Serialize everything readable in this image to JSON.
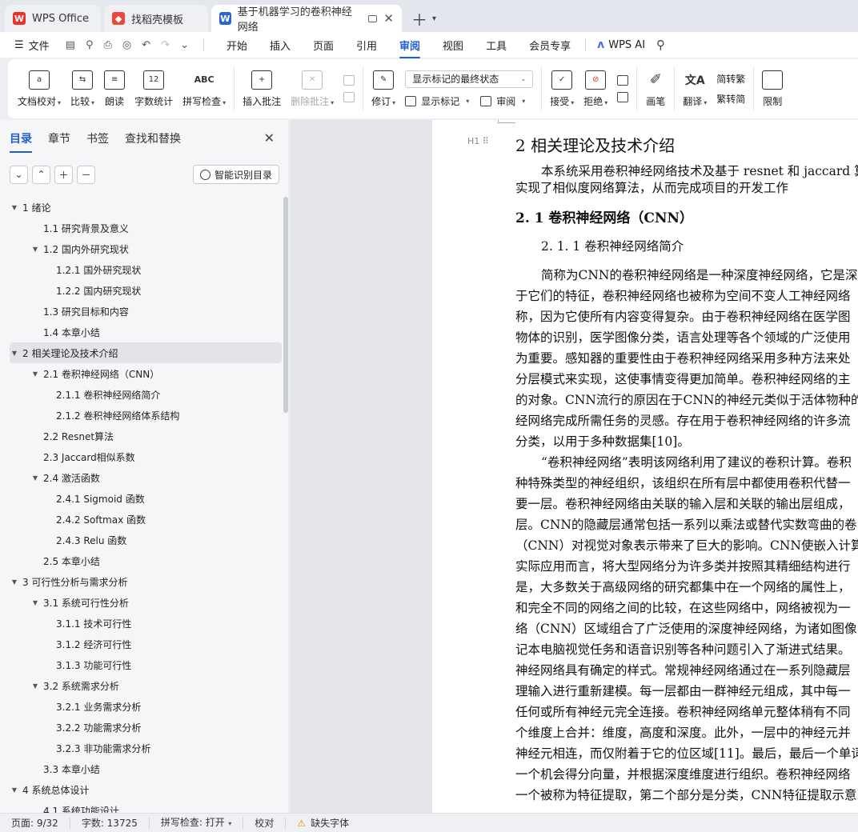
{
  "tabs": {
    "wps": "WPS Office",
    "template": "找稻壳模板",
    "document": "基于机器学习的卷积神经网络"
  },
  "menu": {
    "file": "文件",
    "items": [
      "开始",
      "插入",
      "页面",
      "引用",
      "审阅",
      "视图",
      "工具",
      "会员专享"
    ],
    "active": "审阅",
    "ai": "WPS AI"
  },
  "ribbon": {
    "doc_check": "文档校对",
    "compare": "比较",
    "read_aloud": "朗读",
    "word_count": "字数统计",
    "word_count_icon": "12",
    "spell_check": "拼写检查",
    "spell_icon": "ABC",
    "insert_comment": "插入批注",
    "delete_comment": "删除批注",
    "revise": "修订",
    "markup_mode": "显示标记的最终状态",
    "show_markup": "显示标记",
    "review": "审阅",
    "accept": "接受",
    "reject": "拒绝",
    "pen": "画笔",
    "translate": "翻译",
    "to_traditional": "简转繁",
    "to_simplified": "繁转简",
    "restrict": "限制"
  },
  "nav": {
    "tabs": [
      "目录",
      "章节",
      "书签",
      "查找和替换"
    ],
    "smart_toc": "智能识别目录",
    "toc": [
      {
        "label": "1  绪论",
        "level": 0,
        "arrow": true
      },
      {
        "label": "1.1  研究背景及意义",
        "level": 1
      },
      {
        "label": "1.2  国内外研究现状",
        "level": 1,
        "arrow": true
      },
      {
        "label": "1.2.1  国外研究现状",
        "level": 2
      },
      {
        "label": "1.2.2  国内研究现状",
        "level": 2
      },
      {
        "label": "1.3  研究目标和内容",
        "level": 1
      },
      {
        "label": "1.4  本章小结",
        "level": 1
      },
      {
        "label": "2  相关理论及技术介绍",
        "level": 0,
        "arrow": true,
        "selected": true
      },
      {
        "label": "2.1  卷积神经网络（CNN）",
        "level": 1,
        "arrow": true
      },
      {
        "label": "2.1.1  卷积神经网络简介",
        "level": 2
      },
      {
        "label": "2.1.2  卷积神经网络体系结构",
        "level": 2
      },
      {
        "label": "2.2 Resnet算法",
        "level": 1
      },
      {
        "label": "2.3 Jaccard相似系数",
        "level": 1
      },
      {
        "label": "2.4  激活函数",
        "level": 1,
        "arrow": true
      },
      {
        "label": "2.4.1 Sigmoid 函数",
        "level": 2
      },
      {
        "label": "2.4.2 Softmax 函数",
        "level": 2
      },
      {
        "label": "2.4.3 Relu 函数",
        "level": 2
      },
      {
        "label": "2.5  本章小结",
        "level": 1
      },
      {
        "label": "3 可行性分析与需求分析",
        "level": 0,
        "arrow": true
      },
      {
        "label": "3.1  系统可行性分析",
        "level": 1,
        "arrow": true
      },
      {
        "label": "3.1.1 技术可行性",
        "level": 2
      },
      {
        "label": "3.1.2 经济可行性",
        "level": 2
      },
      {
        "label": "3.1.3 功能可行性",
        "level": 2
      },
      {
        "label": "3.2  系统需求分析",
        "level": 1,
        "arrow": true
      },
      {
        "label": "3.2.1  业务需求分析",
        "level": 2
      },
      {
        "label": "3.2.2  功能需求分析",
        "level": 2
      },
      {
        "label": "3.2.3  非功能需求分析",
        "level": 2
      },
      {
        "label": "3.3  本章小结",
        "level": 1
      },
      {
        "label": "4  系统总体设计",
        "level": 0,
        "arrow": true
      },
      {
        "label": "4.1  系统功能设计",
        "level": 1
      }
    ]
  },
  "doc": {
    "heading_marker": "H1",
    "h1": "2  相关理论及技术介绍",
    "intro": [
      "本系统采用卷积神经网络技术及基于 resnet 和 jaccard 算法",
      "实现了相似度网络算法，从而完成项目的开发工作"
    ],
    "h2": "2. 1  卷积神经网络（CNN）",
    "h3": "2. 1. 1  卷积神经网络简介",
    "body": [
      "简称为CNN的卷积神经网络是一种深度神经网络，它是深度",
      "于它们的特征，卷积神经网络也被称为空间不变人工神经网络",
      "称，因为它使所有内容变得复杂。由于卷积神经网络在医学图",
      "物体的识别，医学图像分类，语言处理等各个领域的广泛使用",
      "为重要。感知器的重要性由于卷积神经网络采用多种方法来处",
      "分层模式来实现，这使事情变得更加简单。卷积神经网络的主",
      "的对象。CNN流行的原因在于CNN的神经元类似于活体物种的",
      "经网络完成所需任务的灵感。存在用于卷积神经网络的许多流",
      "分类，以用于多种数据集[10]。",
      "“卷积神经网络”表明该网络利用了建议的卷积计算。卷积",
      "种特殊类型的神经组织，该组织在所有层中都使用卷积代替一",
      "要一层。卷积神经网络由关联的输入层和关联的输出层组成，",
      "层。CNN的隐藏层通常包括一系列以乘法或替代实数弯曲的卷",
      "（CNN）对视觉对象表示带来了巨大的影响。CNN使嵌入计算",
      "实际应用而言，将大型网络分为许多类并按照其精细结构进行",
      "是，大多数关于高级网络的研究都集中在一个网络的属性上，",
      "和完全不同的网络之间的比较，在这些网络中，网络被视为一",
      "络（CNN）区域组合了广泛使用的深度神经网络，为诸如图像",
      "记本电脑视觉任务和语音识别等各种问题引入了渐进式结果。",
      "神经网络具有确定的样式。常规神经网络通过在一系列隐藏层",
      "理输入进行重新建模。每一层都由一群神经元组成，其中每一",
      "任何或所有神经元完全连接。卷积神经网络单元整体稍有不同",
      "个维度上合并：维度，高度和深度。此外，一层中的神经元并",
      "神经元相连，而仅附着于它的位区域[11]。最后，最后一个单词",
      "一个机会得分向量，并根据深度维度进行组织。卷积神经网络",
      "一个被称为特征提取，第二个部分是分类，CNN特征提取示意"
    ]
  },
  "status": {
    "page": "页面: 9/32",
    "words": "字数: 13725",
    "spell": "拼写检查: 打开",
    "proof": "校对",
    "missing_font": "缺失字体"
  },
  "colors": {
    "accent": "#1f5fd1",
    "wps_red": "#e8322c",
    "docer_red": "#e84a3c",
    "word_blue": "#2e63d8"
  }
}
